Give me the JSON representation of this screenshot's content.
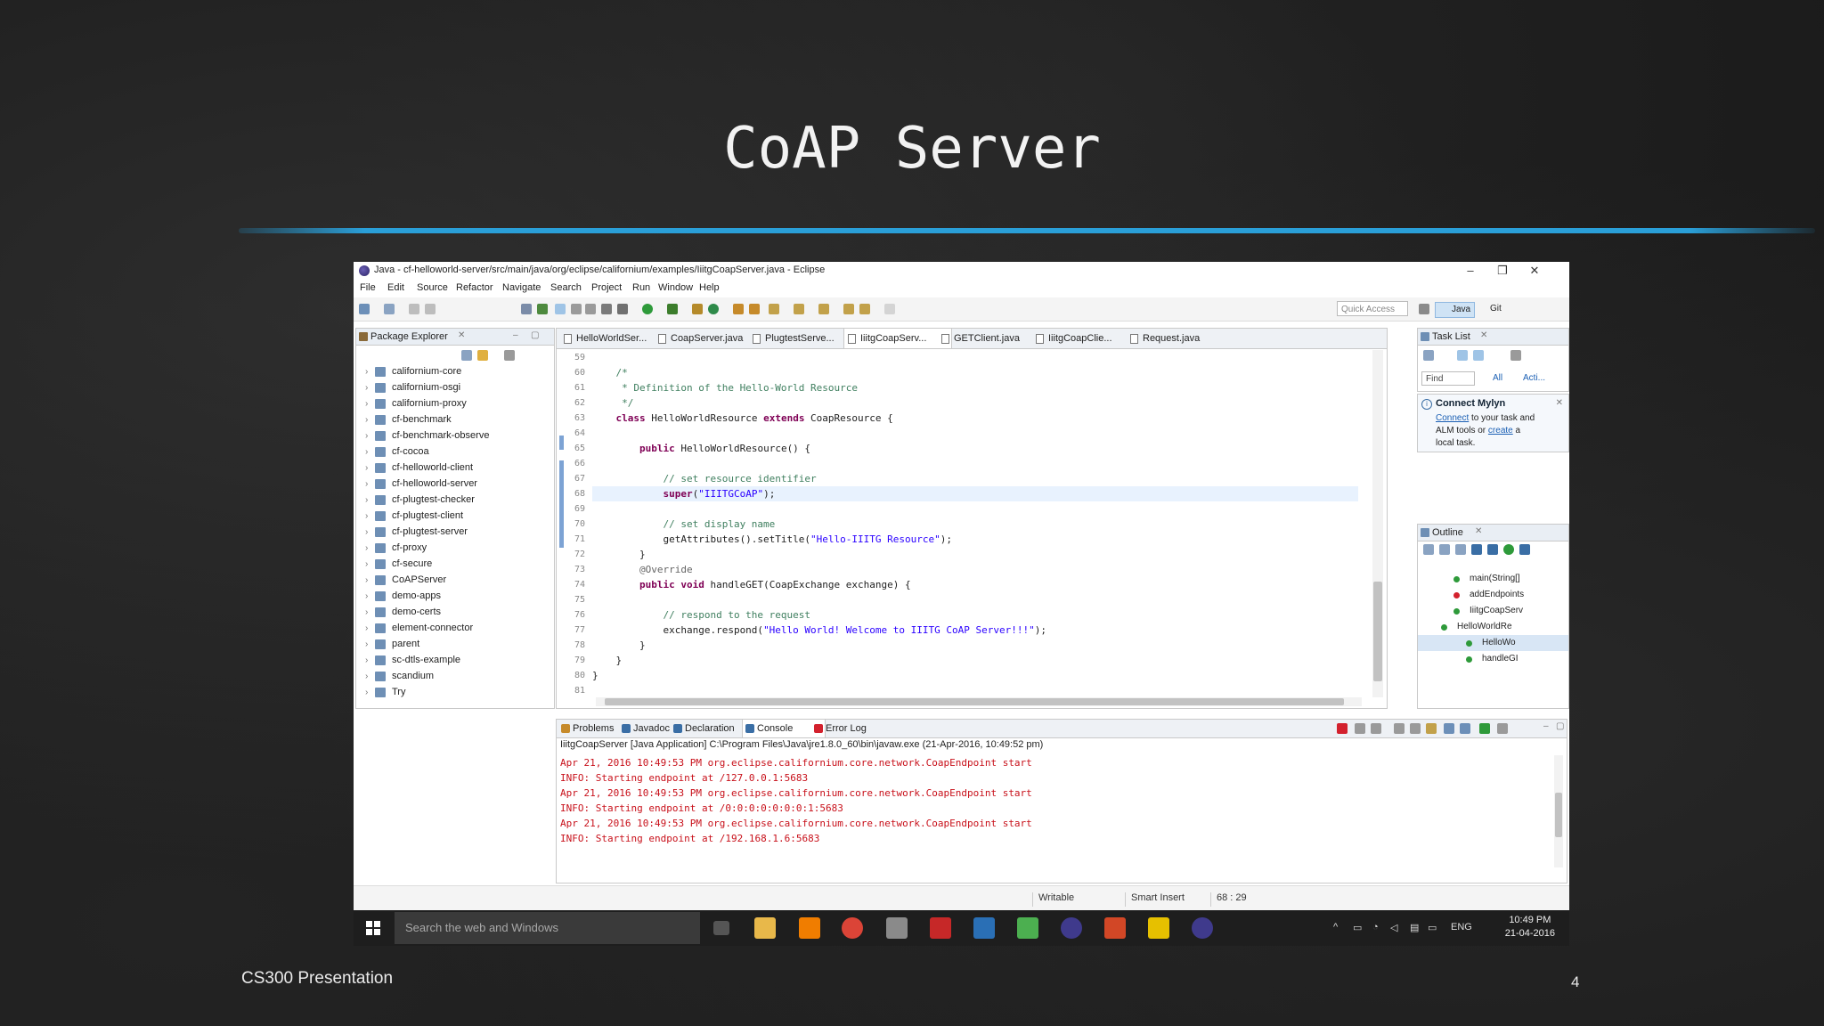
{
  "slide": {
    "title": "CoAP Server",
    "footer_left": "CS300 Presentation",
    "page_number": "4",
    "rule_color": "#2a9fd8"
  },
  "window": {
    "title": "Java - cf-helloworld-server/src/main/java/org/eclipse/californium/examples/IiitgCoapServer.java - Eclipse",
    "controls": [
      "–",
      "❐",
      "✕"
    ]
  },
  "menu": [
    "File",
    "Edit",
    "Source",
    "Refactor",
    "Navigate",
    "Search",
    "Project",
    "Run",
    "Window",
    "Help"
  ],
  "toolbar": {
    "quick_access": "Quick Access",
    "perspectives": [
      "Java",
      "Git"
    ]
  },
  "package_explorer": {
    "title": "Package Explorer",
    "items": [
      "californium-core",
      "californium-osgi",
      "californium-proxy",
      "cf-benchmark",
      "cf-benchmark-observe",
      "cf-cocoa",
      "cf-helloworld-client",
      "cf-helloworld-server",
      "cf-plugtest-checker",
      "cf-plugtest-client",
      "cf-plugtest-server",
      "cf-proxy",
      "cf-secure",
      "CoAPServer",
      "demo-apps",
      "demo-certs",
      "element-connector",
      "parent",
      "sc-dtls-example",
      "scandium",
      "Try"
    ]
  },
  "editor": {
    "tabs": [
      "HelloWorldSer...",
      "CoapServer.java",
      "PlugtestServe...",
      "IiitgCoapServ...",
      "GETClient.java",
      "IiitgCoapClie...",
      "Request.java"
    ],
    "active_tab_index": 3,
    "highlighted_line": "68",
    "lines": [
      {
        "n": "59",
        "text": ""
      },
      {
        "n": "60",
        "text": "    /*"
      },
      {
        "n": "61",
        "text": "     * Definition of the Hello-World Resource"
      },
      {
        "n": "62",
        "text": "     */"
      },
      {
        "n": "63",
        "text": "    class HelloWorldResource extends CoapResource {"
      },
      {
        "n": "64",
        "text": ""
      },
      {
        "n": "65",
        "text": "        public HelloWorldResource() {"
      },
      {
        "n": "66",
        "text": ""
      },
      {
        "n": "67",
        "text": "            // set resource identifier"
      },
      {
        "n": "68",
        "text": "            super(\"IIITGCoAP\");"
      },
      {
        "n": "69",
        "text": ""
      },
      {
        "n": "70",
        "text": "            // set display name"
      },
      {
        "n": "71",
        "text": "            getAttributes().setTitle(\"Hello-IIITG Resource\");"
      },
      {
        "n": "72",
        "text": "        }"
      },
      {
        "n": "73",
        "text": "        @Override"
      },
      {
        "n": "74",
        "text": "        public void handleGET(CoapExchange exchange) {"
      },
      {
        "n": "75",
        "text": ""
      },
      {
        "n": "76",
        "text": "            // respond to the request"
      },
      {
        "n": "77",
        "text": "            exchange.respond(\"Hello World! Welcome to IIITG CoAP Server!!!\");"
      },
      {
        "n": "78",
        "text": "        }"
      },
      {
        "n": "79",
        "text": "    }"
      },
      {
        "n": "80",
        "text": "}"
      },
      {
        "n": "81",
        "text": ""
      }
    ]
  },
  "task_list": {
    "title": "Task List",
    "find_placeholder": "Find",
    "all_label": "All",
    "acti_label": "Acti..."
  },
  "mylyn": {
    "title": "Connect Mylyn",
    "connect_link": "Connect",
    "text1": " to your task and",
    "text2": "ALM tools or ",
    "create_link": "create",
    "text3": " a",
    "text4": "local task."
  },
  "outline": {
    "title": "Outline",
    "items": [
      "main(String[]",
      "addEndpoints",
      "IiitgCoapServ",
      "HelloWorldRe",
      "HelloWo",
      "handleGI"
    ]
  },
  "console": {
    "tabs": [
      "Problems",
      "Javadoc",
      "Declaration",
      "Console",
      "Error Log"
    ],
    "active_tab_index": 3,
    "header": "IiitgCoapServer [Java Application] C:\\Program Files\\Java\\jre1.8.0_60\\bin\\javaw.exe (21-Apr-2016, 10:49:52 pm)",
    "lines": [
      "Apr 21, 2016 10:49:53 PM org.eclipse.californium.core.network.CoapEndpoint start",
      "INFO: Starting endpoint at /127.0.0.1:5683",
      "Apr 21, 2016 10:49:53 PM org.eclipse.californium.core.network.CoapEndpoint start",
      "INFO: Starting endpoint at /0:0:0:0:0:0:0:1:5683",
      "Apr 21, 2016 10:49:53 PM org.eclipse.californium.core.network.CoapEndpoint start",
      "INFO: Starting endpoint at /192.168.1.6:5683"
    ],
    "text_color": "#c8101a"
  },
  "status": {
    "writable": "Writable",
    "insert_mode": "Smart Insert",
    "position": "68 : 29"
  },
  "taskbar": {
    "search_placeholder": "Search the web and Windows",
    "language": "ENG",
    "time": "10:49 PM",
    "date": "21-04-2016"
  }
}
